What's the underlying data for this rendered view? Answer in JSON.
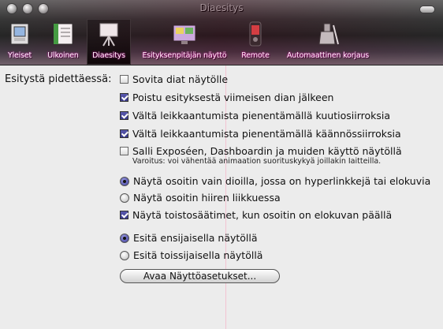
{
  "window": {
    "title": "Diaesitys"
  },
  "toolbar": {
    "items": [
      {
        "label": "Yleiset",
        "icon": "general-icon"
      },
      {
        "label": "Ulkoinen",
        "icon": "appearance-icon"
      },
      {
        "label": "Diaesitys",
        "icon": "slideshow-icon",
        "selected": true
      },
      {
        "label": "Esityksenpitäjän näyttö",
        "icon": "presenter-display-icon"
      },
      {
        "label": "Remote",
        "icon": "remote-icon"
      },
      {
        "label": "Automaattinen korjaus",
        "icon": "autocorrection-icon"
      }
    ]
  },
  "slideshow": {
    "section_label": "Esitystä pidettäessä:",
    "options": [
      {
        "label": "Sovita diat näytölle",
        "type": "checkbox",
        "checked": false
      },
      {
        "label": "Poistu esityksestä viimeisen dian jälkeen",
        "type": "checkbox",
        "checked": true
      },
      {
        "label": "Vältä leikkaantumista pienentämällä kuutiosiirroksia",
        "type": "checkbox",
        "checked": true
      },
      {
        "label": "Vältä leikkaantumista pienentämällä käännössiirroksia",
        "type": "checkbox",
        "checked": true
      },
      {
        "label": "Salli Exposéen, Dashboardin ja muiden käyttö näytöllä",
        "type": "checkbox",
        "checked": false
      },
      {
        "label": "Näytä osoitin vain dioilla, jossa on hyperlinkkejä tai elokuvia",
        "type": "radio",
        "checked": true
      },
      {
        "label": "Näytä osoitin hiiren liikkuessa",
        "type": "radio",
        "checked": false
      },
      {
        "label": "Näytä toistosäätimet, kun osoitin on elokuvan päällä",
        "type": "checkbox",
        "checked": true
      },
      {
        "label": "Esitä ensijaisella näytöllä",
        "type": "radio",
        "checked": true
      },
      {
        "label": "Esitä toissijaisella näytöllä",
        "type": "radio",
        "checked": false
      }
    ],
    "warning": "Varoitus: voi vähentää animaation suorituskykyä joillakin Iaitteilla.",
    "button_label": "Avaa Näyttöasetukset..."
  }
}
